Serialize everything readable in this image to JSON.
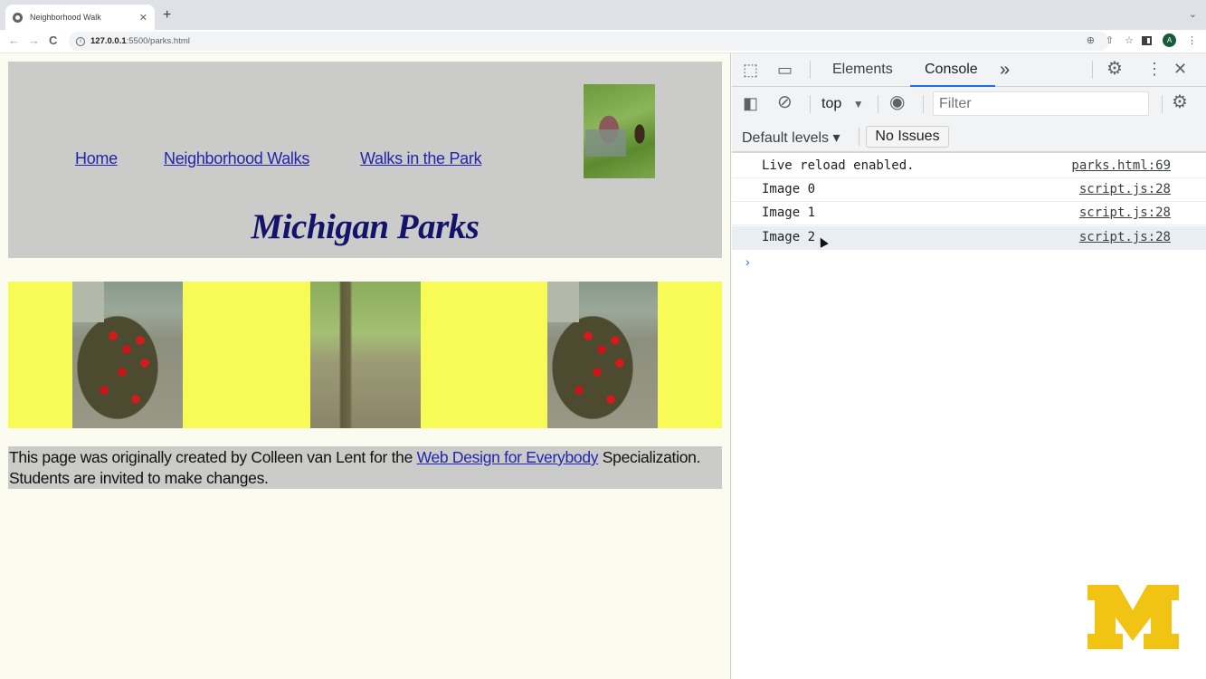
{
  "browser": {
    "tab_title": "Neighborhood Walk",
    "tab_close": "✕",
    "new_tab": "+",
    "tabs_menu": "⌄",
    "back": "←",
    "forward": "→",
    "reload": "C",
    "url_host": "127.0.0.1",
    "url_rest": ":5500/parks.html",
    "profile_initial": "A",
    "omni_icons": [
      "zoom-icon",
      "share-icon",
      "bookmark-star-icon"
    ]
  },
  "page": {
    "nav": [
      {
        "label": "Home"
      },
      {
        "label": "Neighborhood Walks"
      },
      {
        "label": "Walks in the Park"
      }
    ],
    "title": "Michigan Parks",
    "gallery": [
      {
        "alt": "tulips-flowerbed"
      },
      {
        "alt": "forest-tree"
      },
      {
        "alt": "tulips-flowerbed"
      }
    ],
    "footer": {
      "text_before": "This page was originally created by Colleen van Lent for the ",
      "link": "Web Design for Everybody",
      "text_after": " Specialization. Students are invited to make changes."
    },
    "colors": {
      "header_bg": "#cbccc9",
      "gallery_bg": "#f8fb55",
      "link": "#2323b0",
      "title": "#13136b"
    }
  },
  "devtools": {
    "tabs": [
      {
        "label": "Elements",
        "active": false
      },
      {
        "label": "Console",
        "active": true
      }
    ],
    "more_tabs": "»",
    "context": "top",
    "filter_placeholder": "Filter",
    "levels": "Default levels ▾",
    "issues": "No Issues",
    "console": [
      {
        "message": "Live reload enabled.",
        "source": "parks.html:69"
      },
      {
        "message": "Image 0",
        "source": "script.js:28"
      },
      {
        "message": "Image 1",
        "source": "script.js:28"
      },
      {
        "message": "Image 2",
        "source": "script.js:28"
      }
    ],
    "prompt": "›"
  },
  "overlay": {
    "logo": "University of Michigan block M",
    "logo_color": "#f1c413"
  }
}
